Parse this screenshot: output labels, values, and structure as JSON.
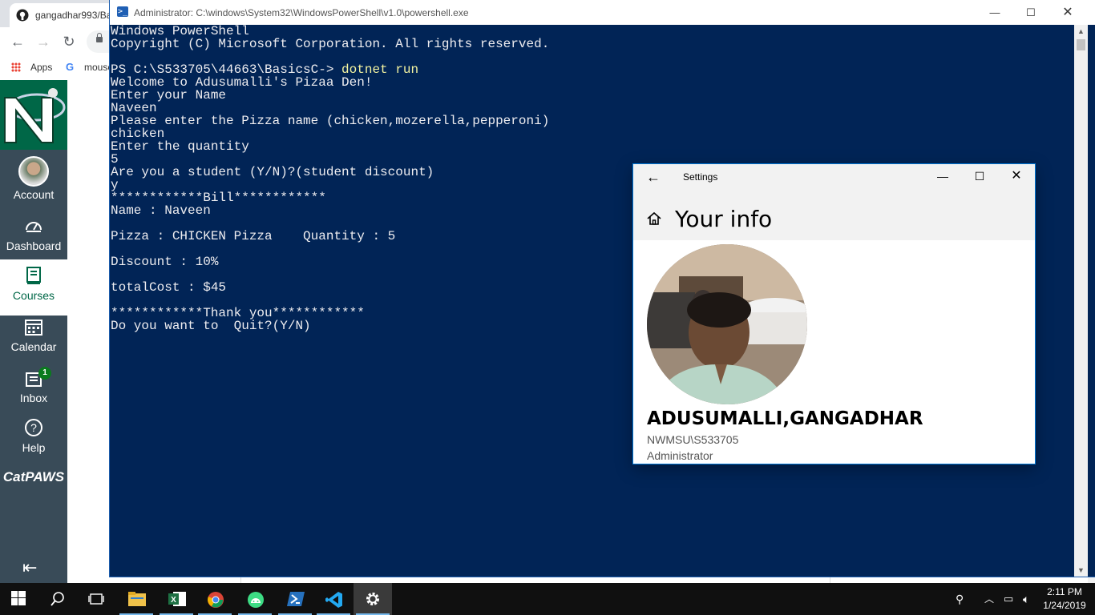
{
  "browser": {
    "tab_title": "gangadhar993/Ba",
    "bookmarks": {
      "apps": "Apps",
      "google": "mouse"
    }
  },
  "canvas": {
    "nav": [
      {
        "label": "Account"
      },
      {
        "label": "Dashboard"
      },
      {
        "label": "Courses"
      },
      {
        "label": "Calendar"
      },
      {
        "label": "Inbox",
        "badge": "1"
      },
      {
        "label": "Help"
      }
    ],
    "brand": "CatPAWS",
    "active_color": "#006747"
  },
  "powershell": {
    "title": "Administrator: C:\\windows\\System32\\WindowsPowerShell\\v1.0\\powershell.exe",
    "lines": [
      "Windows PowerShell",
      "Copyright (C) Microsoft Corporation. All rights reserved.",
      "",
      "PS C:\\S533705\\44663\\BasicsC-> ",
      "Welcome to Adusumalli's Pizaa Den!",
      "Enter your Name",
      "Naveen",
      "Please enter the Pizza name (chicken,mozerella,pepperoni)",
      "chicken",
      "Enter the quantity",
      "5",
      "Are you a student (Y/N)?(student discount)",
      "y",
      "************Bill************",
      "Name : Naveen",
      "",
      "Pizza : CHICKEN Pizza    Quantity : 5",
      "",
      "Discount : 10%",
      "",
      "totalCost : $45",
      "",
      "************Thank you************",
      "Do you want to  Quit?(Y/N)"
    ],
    "command": "dotnet run",
    "background": "#012456"
  },
  "settings": {
    "title": "Settings",
    "heading": "Your info",
    "name": "ADUSUMALLI,GANGADHAR",
    "account": "NWMSU\\S533705",
    "role": "Administrator"
  },
  "taskbar": {
    "time": "2:11 PM",
    "date": "1/24/2019",
    "apps": [
      "start-icon",
      "search-icon",
      "task-view-icon",
      "file-explorer-icon",
      "excel-icon",
      "chrome-icon",
      "android-studio-icon",
      "powershell-icon",
      "vscode-icon",
      "settings-icon"
    ]
  }
}
